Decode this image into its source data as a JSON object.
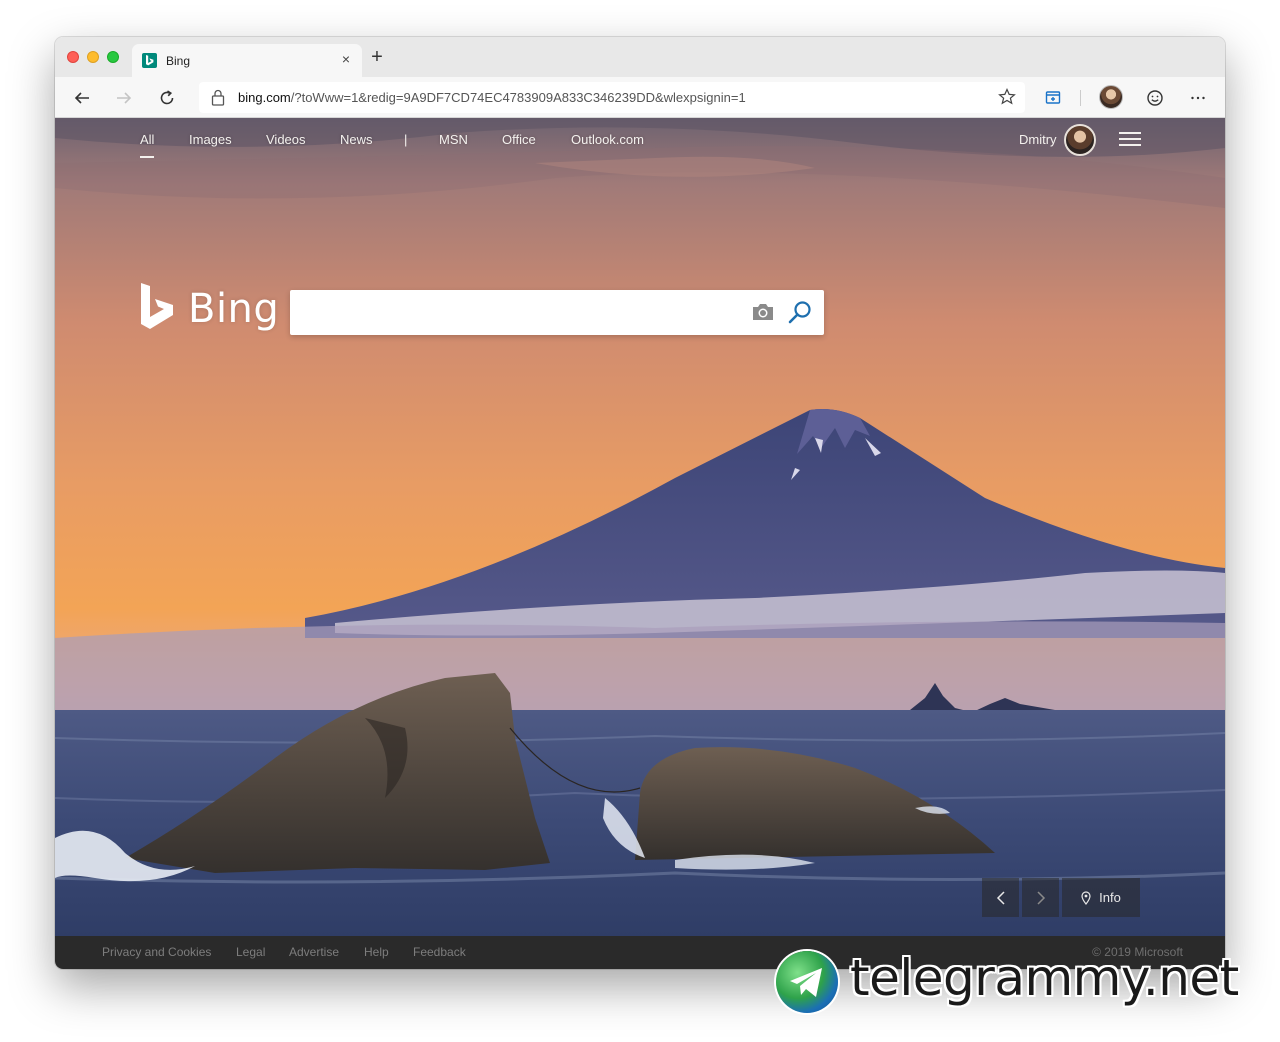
{
  "browser": {
    "tab": {
      "title": "Bing",
      "favicon": "bing-favicon",
      "close_icon": "×"
    },
    "new_tab_icon": "+",
    "address_url_host": "bing.com",
    "address_url_rest": "/?toWww=1&redig=9A9DF7CD74EC4783909A833C346239DD&wlexpsignin=1"
  },
  "nav": {
    "items": [
      "All",
      "Images",
      "Videos",
      "News"
    ],
    "divider": "|",
    "more_items": [
      "MSN",
      "Office",
      "Outlook.com"
    ],
    "active": "All"
  },
  "user": {
    "name": "Dmitry"
  },
  "brand": {
    "name": "Bing",
    "accent": "#00809d"
  },
  "search": {
    "placeholder": "",
    "value": ""
  },
  "carousel": {
    "info_label": "Info"
  },
  "footer": {
    "links": [
      "Privacy and Cookies",
      "Legal",
      "Advertise",
      "Help",
      "Feedback"
    ],
    "copyright": "© 2019 Microsoft"
  },
  "watermark": {
    "text": "telegrammy.net"
  }
}
